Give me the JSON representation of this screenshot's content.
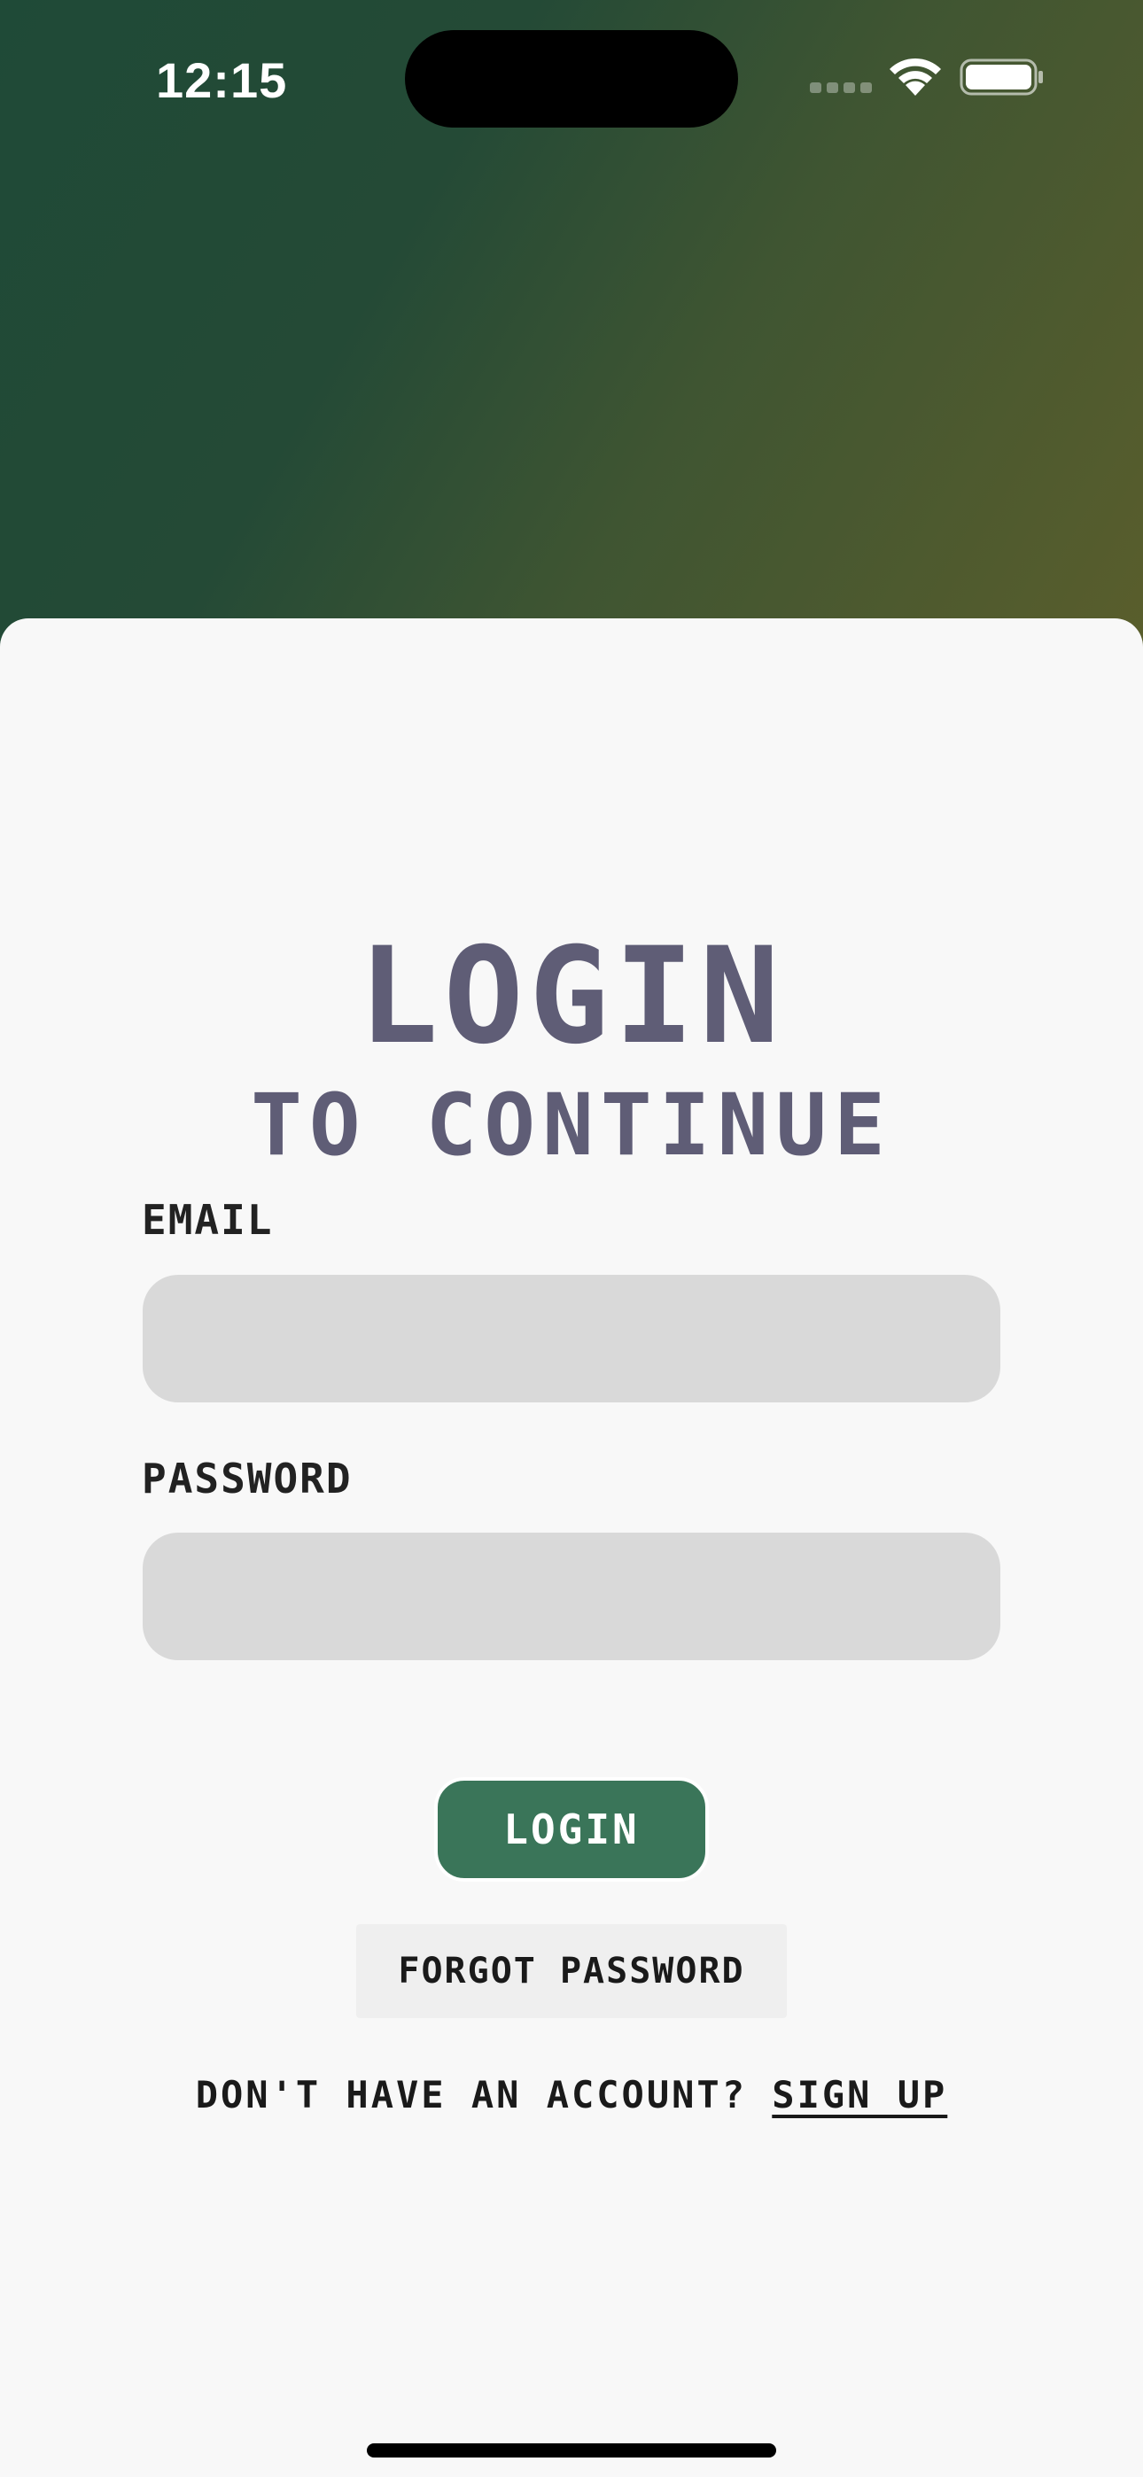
{
  "status_bar": {
    "time": "12:15",
    "icons": [
      "cellular-signal-icon",
      "wifi-icon",
      "battery-icon"
    ]
  },
  "heading": {
    "title": "LOGIN",
    "subtitle": "TO CONTINUE"
  },
  "form": {
    "email_label": "EMAIL",
    "email_value": "",
    "password_label": "PASSWORD",
    "password_value": "",
    "login_label": "LOGIN",
    "forgot_label": "FORGOT PASSWORD"
  },
  "footer": {
    "prompt": "DON'T HAVE AN ACCOUNT? ",
    "signup_label": "SIGN UP"
  },
  "colors": {
    "header_gradient_start": "#1f4a37",
    "header_gradient_end": "#5a5e2c",
    "sheet_background": "#f8f8f8",
    "title_color": "#5f5d76",
    "input_background": "#d9d9d9",
    "primary_button": "#3a7559"
  }
}
